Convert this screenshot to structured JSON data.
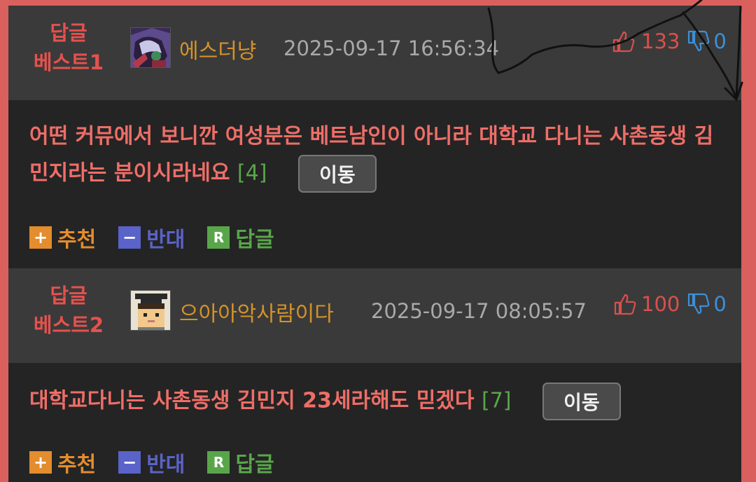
{
  "comments": [
    {
      "rank_label_1": "답글",
      "rank_label_2": "베스트1",
      "avatar": "anime-character-avatar",
      "nickname": "에스더냥",
      "timestamp": "2025-09-17 16:56:34",
      "up_count": "133",
      "down_count": "0",
      "text": "어떤 커뮤에서 보니깐 여성분은 베트남인이 아니라 대학교 다니는 사촌동생 김민지라는 분이시라네요",
      "reply_count": "[4]",
      "move_label": "이동",
      "recommend_label": "추천",
      "oppose_label": "반대",
      "reply_label": "답글"
    },
    {
      "rank_label_1": "답글",
      "rank_label_2": "베스트2",
      "avatar": "pixel-graduate-avatar",
      "nickname": "으아아악사람이다",
      "timestamp": "2025-09-17 08:05:57",
      "up_count": "100",
      "down_count": "0",
      "text": "대학교다니는 사촌동생 김민지 23세라해도 믿겠다",
      "reply_count": "[7]",
      "move_label": "이동",
      "recommend_label": "추천",
      "oppose_label": "반대",
      "reply_label": "답글"
    }
  ],
  "icons": {
    "recommend": "plus-icon",
    "oppose": "minus-icon",
    "reply": "reply-r-icon",
    "thumbs_up": "thumbs-up-icon",
    "thumbs_down": "thumbs-down-icon"
  },
  "colors": {
    "frame": "#d9605c",
    "badge": "#e5514e",
    "nickname": "#d4922a",
    "comment_text": "#ee6e68",
    "reply_count": "#59a64a",
    "recommend": "#e38d2e",
    "oppose": "#5a63c8",
    "reply": "#59a64a",
    "up": "#d9504d",
    "down": "#3d8fd9"
  }
}
